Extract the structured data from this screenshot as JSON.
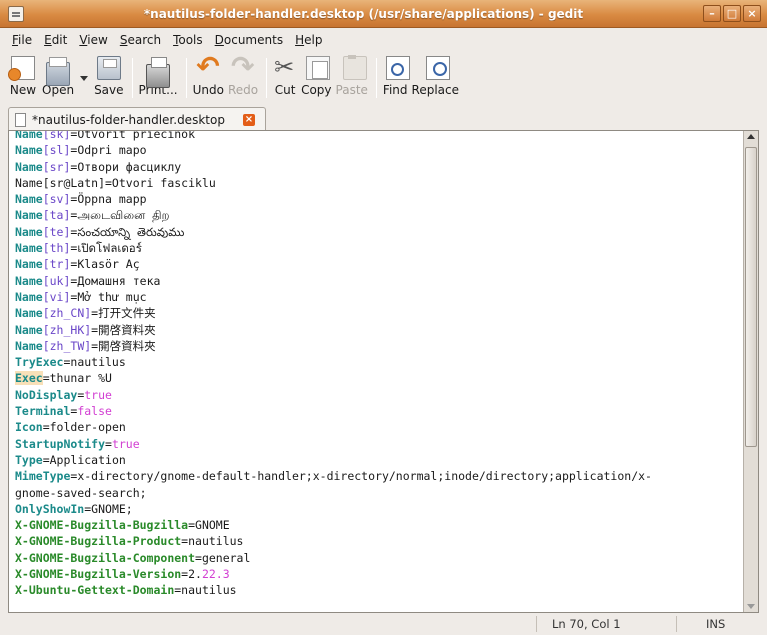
{
  "window": {
    "title": "*nautilus-folder-handler.desktop (/usr/share/applications) - gedit",
    "buttons": {
      "minimize": "–",
      "maximize": "□",
      "close": "×"
    }
  },
  "menubar": {
    "items": [
      {
        "ul": "F",
        "rest": "ile"
      },
      {
        "ul": "E",
        "rest": "dit"
      },
      {
        "ul": "V",
        "rest": "iew"
      },
      {
        "ul": "S",
        "rest": "earch"
      },
      {
        "ul": "T",
        "rest": "ools"
      },
      {
        "ul": "D",
        "rest": "ocuments"
      },
      {
        "ul": "H",
        "rest": "elp"
      }
    ]
  },
  "toolbar": {
    "new": "New",
    "open": "Open",
    "save": "Save",
    "print": "Print...",
    "undo": "Undo",
    "redo": "Redo",
    "cut": "Cut",
    "copy": "Copy",
    "paste": "Paste",
    "find": "Find",
    "replace": "Replace"
  },
  "tab": {
    "label": "*nautilus-folder-handler.desktop",
    "close": "×"
  },
  "editor": {
    "lines": [
      [
        [
          "k",
          "Name"
        ],
        [
          "o",
          "[sk]"
        ],
        [
          "v",
          "=Otvoriť priečinok"
        ]
      ],
      [
        [
          "k",
          "Name"
        ],
        [
          "o",
          "[sl]"
        ],
        [
          "v",
          "=Odpri mapo"
        ]
      ],
      [
        [
          "k",
          "Name"
        ],
        [
          "o",
          "[sr]"
        ],
        [
          "v",
          "=Отвори фасциклу"
        ]
      ],
      [
        [
          "v",
          "Name[sr@Latn]=Otvori fasciklu"
        ]
      ],
      [
        [
          "k",
          "Name"
        ],
        [
          "o",
          "[sv]"
        ],
        [
          "v",
          "=Öppna mapp"
        ]
      ],
      [
        [
          "k",
          "Name"
        ],
        [
          "o",
          "[ta]"
        ],
        [
          "v",
          "=அடைவினை திற"
        ]
      ],
      [
        [
          "k",
          "Name"
        ],
        [
          "o",
          "[te]"
        ],
        [
          "v",
          "=సంచయాన్ని తెరువుము"
        ]
      ],
      [
        [
          "k",
          "Name"
        ],
        [
          "o",
          "[th]"
        ],
        [
          "v",
          "=เปิดโฟลเดอร์"
        ]
      ],
      [
        [
          "k",
          "Name"
        ],
        [
          "o",
          "[tr]"
        ],
        [
          "v",
          "=Klasör Aç"
        ]
      ],
      [
        [
          "k",
          "Name"
        ],
        [
          "o",
          "[uk]"
        ],
        [
          "v",
          "=Домашня тека"
        ]
      ],
      [
        [
          "k",
          "Name"
        ],
        [
          "o",
          "[vi]"
        ],
        [
          "v",
          "=Mở thư mục"
        ]
      ],
      [
        [
          "k",
          "Name"
        ],
        [
          "o",
          "[zh_CN]"
        ],
        [
          "v",
          "=打开文件夹"
        ]
      ],
      [
        [
          "k",
          "Name"
        ],
        [
          "o",
          "[zh_HK]"
        ],
        [
          "v",
          "=開啓資料夾"
        ]
      ],
      [
        [
          "k",
          "Name"
        ],
        [
          "o",
          "[zh_TW]"
        ],
        [
          "v",
          "=開啓資料夾"
        ]
      ],
      [
        [
          "k",
          "TryExec"
        ],
        [
          "v",
          "=nautilus"
        ]
      ],
      [
        [
          "k",
          "Exec"
        ],
        [
          "v",
          "=thunar %U"
        ]
      ],
      [
        [
          "k",
          "NoDisplay"
        ],
        [
          "v",
          "="
        ],
        [
          "p",
          "true"
        ]
      ],
      [
        [
          "k",
          "Terminal"
        ],
        [
          "v",
          "="
        ],
        [
          "p",
          "false"
        ]
      ],
      [
        [
          "k",
          "Icon"
        ],
        [
          "v",
          "=folder-open"
        ]
      ],
      [
        [
          "k",
          "StartupNotify"
        ],
        [
          "v",
          "="
        ],
        [
          "p",
          "true"
        ]
      ],
      [
        [
          "k",
          "Type"
        ],
        [
          "v",
          "=Application"
        ]
      ],
      [
        [
          "k",
          "MimeType"
        ],
        [
          "v",
          "=x-directory/gnome-default-handler;x-directory/normal;inode/directory;application/x-"
        ]
      ],
      [
        [
          "v",
          "gnome-saved-search;"
        ]
      ],
      [
        [
          "k",
          "OnlyShowIn"
        ],
        [
          "v",
          "=GNOME;"
        ]
      ],
      [
        [
          "g",
          "X-GNOME-Bugzilla-Bugzilla"
        ],
        [
          "v",
          "=GNOME"
        ]
      ],
      [
        [
          "g",
          "X-GNOME-Bugzilla-Product"
        ],
        [
          "v",
          "=nautilus"
        ]
      ],
      [
        [
          "g",
          "X-GNOME-Bugzilla-Component"
        ],
        [
          "v",
          "=general"
        ]
      ],
      [
        [
          "g",
          "X-GNOME-Bugzilla-Version"
        ],
        [
          "v",
          "=2."
        ],
        [
          "p",
          "22.3"
        ]
      ],
      [
        [
          "g",
          "X-Ubuntu-Gettext-Domain"
        ],
        [
          "v",
          "=nautilus"
        ]
      ]
    ],
    "highlighted_line": 15
  },
  "statusbar": {
    "position": "Ln 70, Col 1",
    "mode": "INS"
  }
}
